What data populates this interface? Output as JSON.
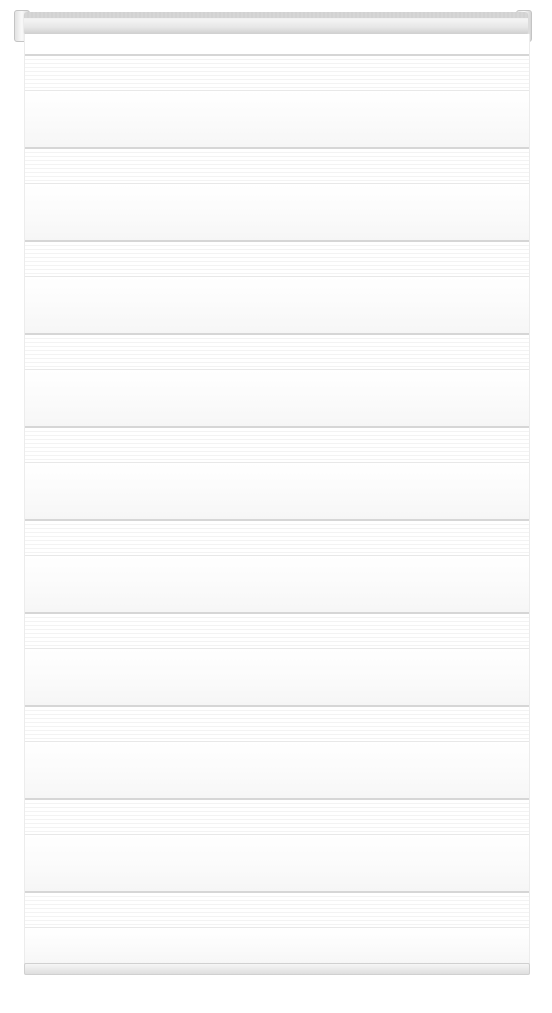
{
  "blind": {
    "type": "day-night zebra roller blind",
    "fabric_color": "#ffffff",
    "headrail_color": "#e6e6e6",
    "sheer_stripe_color": "#f3f3f3",
    "solid_band_count": 10,
    "sheer_band_count": 10
  }
}
